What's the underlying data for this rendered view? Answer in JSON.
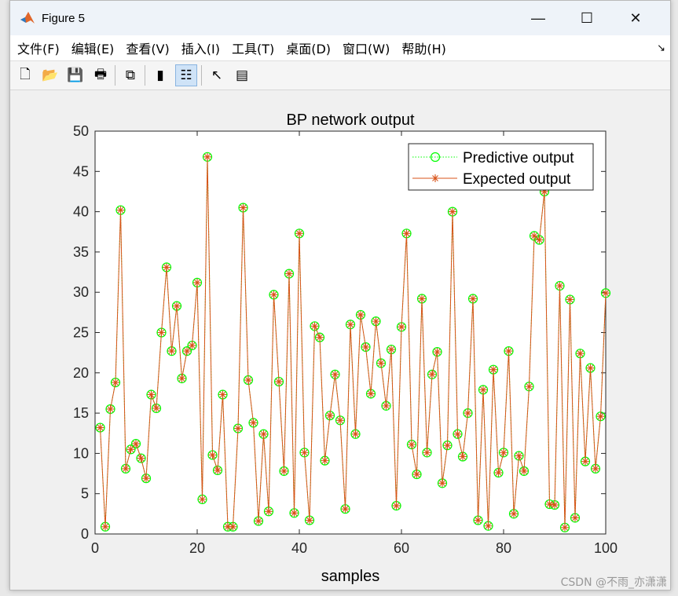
{
  "window": {
    "title": "Figure 5",
    "minimize": "—",
    "maximize": "☐",
    "close": "✕"
  },
  "menu": [
    "文件(F)",
    "编辑(E)",
    "查看(V)",
    "插入(I)",
    "工具(T)",
    "桌面(D)",
    "窗口(W)",
    "帮助(H)"
  ],
  "menu_overflow": "↘",
  "toolbar": [
    {
      "icon": "new-figure-icon",
      "glyph": "🗋"
    },
    {
      "icon": "open-file-icon",
      "glyph": "📂"
    },
    {
      "icon": "save-icon",
      "glyph": "💾"
    },
    {
      "icon": "print-icon",
      "glyph": "🖶"
    },
    {
      "icon": "link-plot-icon",
      "glyph": "⧉"
    },
    {
      "icon": "colorbar-icon",
      "glyph": "▮"
    },
    {
      "icon": "legend-icon",
      "glyph": "☷",
      "active": true
    },
    {
      "icon": "pointer-icon",
      "glyph": "↖"
    },
    {
      "icon": "property-editor-icon",
      "glyph": "▤"
    }
  ],
  "watermark": "CSDN @不雨_亦潇潇",
  "chart_data": {
    "type": "line",
    "title": "BP network output",
    "xlabel": "samples",
    "ylabel": "",
    "xlim": [
      0,
      100
    ],
    "ylim": [
      0,
      50
    ],
    "xticks": [
      0,
      20,
      40,
      60,
      80,
      100
    ],
    "yticks": [
      0,
      5,
      10,
      15,
      20,
      25,
      30,
      35,
      40,
      45,
      50
    ],
    "grid": false,
    "legend_position": "top-right",
    "x": [
      1,
      2,
      3,
      4,
      5,
      6,
      7,
      8,
      9,
      10,
      11,
      12,
      13,
      14,
      15,
      16,
      17,
      18,
      19,
      20,
      21,
      22,
      23,
      24,
      25,
      26,
      27,
      28,
      29,
      30,
      31,
      32,
      33,
      34,
      35,
      36,
      37,
      38,
      39,
      40,
      41,
      42,
      43,
      44,
      45,
      46,
      47,
      48,
      49,
      50,
      51,
      52,
      53,
      54,
      55,
      56,
      57,
      58,
      59,
      60,
      61,
      62,
      63,
      64,
      65,
      66,
      67,
      68,
      69,
      70,
      71,
      72,
      73,
      74,
      75,
      76,
      77,
      78,
      79,
      80,
      81,
      82,
      83,
      84,
      85,
      86,
      87,
      88,
      89,
      90,
      91,
      92,
      93,
      94,
      95,
      96,
      97,
      98,
      99,
      100
    ],
    "series": [
      {
        "name": "Predictive output",
        "color": "#00ff00",
        "line": "dotted",
        "marker": "circle",
        "values": [
          13.2,
          0.9,
          15.5,
          18.8,
          40.2,
          8.1,
          10.5,
          11.2,
          9.4,
          6.9,
          17.3,
          15.6,
          25.0,
          33.1,
          22.7,
          28.3,
          19.3,
          22.7,
          23.4,
          31.2,
          4.3,
          46.8,
          9.8,
          7.9,
          17.3,
          0.9,
          0.9,
          13.1,
          40.5,
          19.1,
          13.8,
          1.6,
          12.4,
          2.8,
          29.7,
          18.9,
          7.8,
          32.3,
          2.6,
          37.3,
          10.1,
          1.7,
          25.8,
          24.4,
          9.1,
          14.7,
          19.8,
          14.1,
          3.1,
          26.0,
          12.4,
          27.2,
          23.2,
          17.4,
          26.4,
          21.2,
          15.9,
          22.9,
          3.5,
          25.7,
          37.3,
          11.1,
          7.4,
          29.2,
          10.1,
          19.8,
          22.6,
          6.3,
          11.0,
          40.0,
          12.4,
          9.6,
          15.0,
          29.2,
          1.7,
          17.9,
          1.0,
          20.4,
          7.6,
          10.1,
          22.7,
          2.5,
          9.7,
          7.8,
          18.3,
          37.0,
          36.5,
          42.5,
          3.7,
          3.6,
          30.8,
          0.8,
          29.1,
          2.0,
          22.4,
          9.0,
          20.6,
          8.1,
          14.6,
          29.9
        ]
      },
      {
        "name": "Expected output",
        "color": "#d95319",
        "line": "solid",
        "marker": "asterisk",
        "values": [
          13.2,
          0.9,
          15.5,
          18.8,
          40.2,
          8.1,
          10.5,
          11.2,
          9.4,
          6.9,
          17.3,
          15.6,
          25.0,
          33.1,
          22.7,
          28.3,
          19.3,
          22.7,
          23.4,
          31.2,
          4.3,
          46.8,
          9.8,
          7.9,
          17.3,
          0.9,
          0.9,
          13.1,
          40.5,
          19.1,
          13.8,
          1.6,
          12.4,
          2.8,
          29.7,
          18.9,
          7.8,
          32.3,
          2.6,
          37.3,
          10.1,
          1.7,
          25.8,
          24.4,
          9.1,
          14.7,
          19.8,
          14.1,
          3.1,
          26.0,
          12.4,
          27.2,
          23.2,
          17.4,
          26.4,
          21.2,
          15.9,
          22.9,
          3.5,
          25.7,
          37.3,
          11.1,
          7.4,
          29.2,
          10.1,
          19.8,
          22.6,
          6.3,
          11.0,
          40.0,
          12.4,
          9.6,
          15.0,
          29.2,
          1.7,
          17.9,
          1.0,
          20.4,
          7.6,
          10.1,
          22.7,
          2.5,
          9.7,
          7.8,
          18.3,
          37.0,
          36.5,
          42.5,
          3.7,
          3.6,
          30.8,
          0.8,
          29.1,
          2.0,
          22.4,
          9.0,
          20.6,
          8.1,
          14.6,
          29.9
        ]
      }
    ]
  }
}
